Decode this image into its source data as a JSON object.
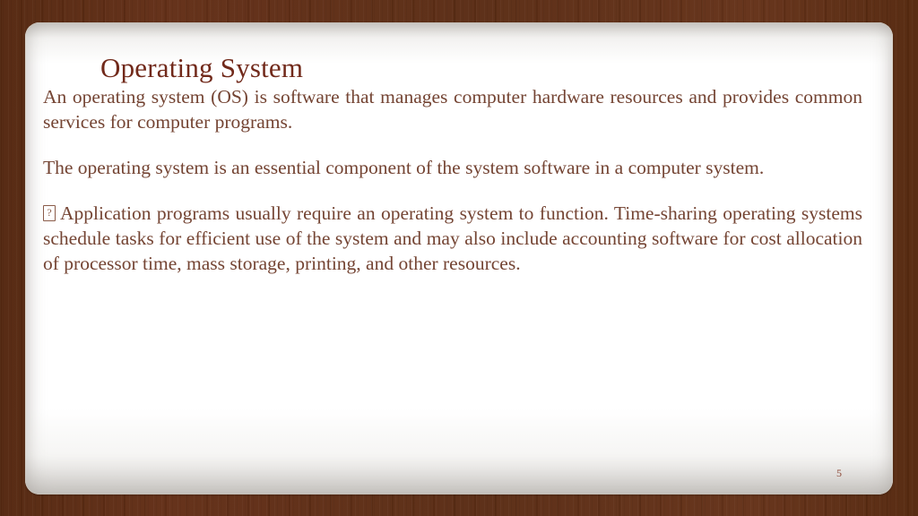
{
  "slide": {
    "title": "Operating System",
    "page_number": "5",
    "colors": {
      "background_brown": "#5e2e16",
      "panel_white": "#ffffff",
      "title_text": "#71291a",
      "body_text": "#744433",
      "page_number_text": "#8e4b3a"
    },
    "paragraphs": [
      {
        "bullet": "",
        "text": "An operating system (OS) is software that manages computer hardware resources and provides common services for computer programs."
      },
      {
        "bullet": "",
        "text": "The operating system is an essential component of the system software in a computer system."
      },
      {
        "bullet": "?",
        "text": "Application programs usually require an operating system to function. Time-sharing operating systems schedule tasks for efficient use of the system and may also include accounting software for cost allocation of processor time, mass storage, printing, and other resources."
      }
    ]
  }
}
